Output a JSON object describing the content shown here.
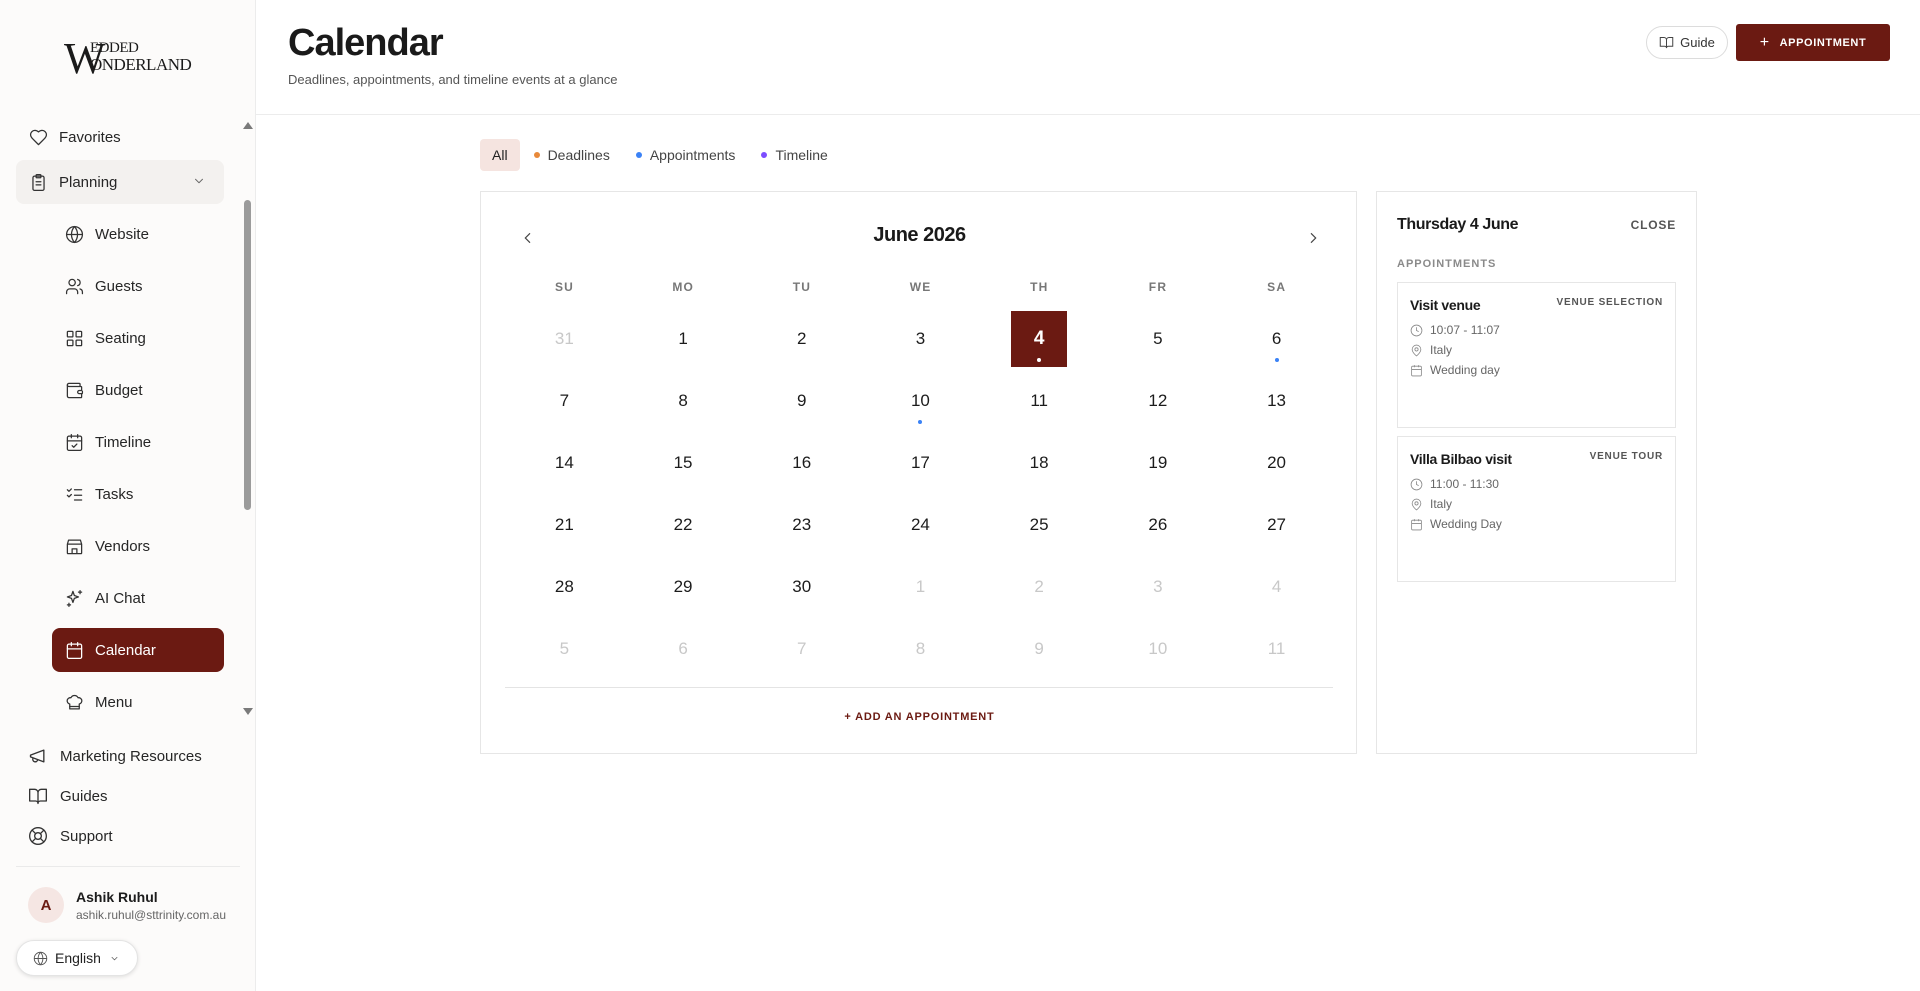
{
  "brand": {
    "logo_mark": "W",
    "logo_line1": "EDDED",
    "logo_line2": "ONDERLAND"
  },
  "sidebar": {
    "favorites": "Favorites",
    "planning": "Planning",
    "sub_items": [
      {
        "label": "Website",
        "icon": "globe-icon"
      },
      {
        "label": "Guests",
        "icon": "users-icon"
      },
      {
        "label": "Seating",
        "icon": "grid-icon"
      },
      {
        "label": "Budget",
        "icon": "wallet-icon"
      },
      {
        "label": "Timeline",
        "icon": "calendar-check-icon"
      },
      {
        "label": "Tasks",
        "icon": "list-checks-icon"
      },
      {
        "label": "Vendors",
        "icon": "store-icon"
      },
      {
        "label": "AI Chat",
        "icon": "sparkles-icon"
      },
      {
        "label": "Calendar",
        "icon": "calendar-icon"
      },
      {
        "label": "Menu",
        "icon": "chef-hat-icon"
      }
    ],
    "bottom_links": [
      {
        "label": "Marketing Resources",
        "icon": "megaphone-icon"
      },
      {
        "label": "Guides",
        "icon": "book-open-icon"
      },
      {
        "label": "Support",
        "icon": "life-buoy-icon"
      }
    ],
    "user": {
      "initial": "A",
      "name": "Ashik Ruhul",
      "email": "ashik.ruhul@sttrinity.com.au"
    },
    "language": "English"
  },
  "header": {
    "title": "Calendar",
    "subtitle": "Deadlines, appointments, and timeline events at a glance",
    "guide_label": "Guide",
    "appointment_label": "APPOINTMENT"
  },
  "filters": [
    {
      "label": "All",
      "active": true,
      "color": ""
    },
    {
      "label": "Deadlines",
      "active": false,
      "color": "#e8893a"
    },
    {
      "label": "Appointments",
      "active": false,
      "color": "#3b82f6"
    },
    {
      "label": "Timeline",
      "active": false,
      "color": "#7c4dff"
    }
  ],
  "calendar": {
    "month_label": "June 2026",
    "weekdays": [
      "SU",
      "MO",
      "TU",
      "WE",
      "TH",
      "FR",
      "SA"
    ],
    "weeks": [
      [
        {
          "d": "31",
          "m": true
        },
        {
          "d": "1"
        },
        {
          "d": "2"
        },
        {
          "d": "3"
        },
        {
          "d": "4",
          "sel": true,
          "dot": "#ffffff"
        },
        {
          "d": "5"
        },
        {
          "d": "6",
          "dot": "#3b82f6"
        }
      ],
      [
        {
          "d": "7"
        },
        {
          "d": "8"
        },
        {
          "d": "9"
        },
        {
          "d": "10",
          "dot": "#3b82f6"
        },
        {
          "d": "11"
        },
        {
          "d": "12"
        },
        {
          "d": "13"
        }
      ],
      [
        {
          "d": "14"
        },
        {
          "d": "15"
        },
        {
          "d": "16"
        },
        {
          "d": "17"
        },
        {
          "d": "18"
        },
        {
          "d": "19"
        },
        {
          "d": "20"
        }
      ],
      [
        {
          "d": "21"
        },
        {
          "d": "22"
        },
        {
          "d": "23"
        },
        {
          "d": "24"
        },
        {
          "d": "25"
        },
        {
          "d": "26"
        },
        {
          "d": "27"
        }
      ],
      [
        {
          "d": "28"
        },
        {
          "d": "29"
        },
        {
          "d": "30"
        },
        {
          "d": "1",
          "m": true
        },
        {
          "d": "2",
          "m": true
        },
        {
          "d": "3",
          "m": true
        },
        {
          "d": "4",
          "m": true
        }
      ],
      [
        {
          "d": "5",
          "m": true
        },
        {
          "d": "6",
          "m": true
        },
        {
          "d": "7",
          "m": true
        },
        {
          "d": "8",
          "m": true
        },
        {
          "d": "9",
          "m": true
        },
        {
          "d": "10",
          "m": true
        },
        {
          "d": "11",
          "m": true
        }
      ]
    ],
    "add_label": "+ ADD AN APPOINTMENT"
  },
  "day_panel": {
    "title": "Thursday 4 June",
    "close_label": "CLOSE",
    "section_label": "APPOINTMENTS",
    "appointments": [
      {
        "title": "Visit venue",
        "tag": "VENUE SELECTION",
        "time": "10:07 - 11:07",
        "location": "Italy",
        "event": "Wedding day"
      },
      {
        "title": "Villa Bilbao visit",
        "tag": "VENUE TOUR",
        "time": "11:00 - 11:30",
        "location": "Italy",
        "event": "Wedding Day"
      }
    ]
  },
  "colors": {
    "accent": "#6b1a12",
    "appointment_dot": "#3b82f6"
  }
}
